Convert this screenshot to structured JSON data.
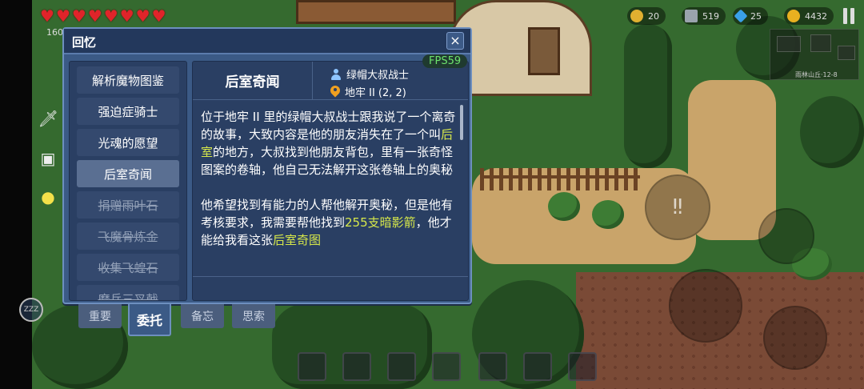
{
  "hud": {
    "hearts": 8,
    "hp_label": "160/",
    "resources": [
      {
        "icon": "star-badge-icon",
        "value": "20",
        "color": "#e0b030"
      },
      {
        "icon": "arrow-ammo-icon",
        "value": "519",
        "color": "#9aa3ad"
      },
      {
        "icon": "blue-gem-icon",
        "value": "25",
        "color": "#3aa0e8"
      },
      {
        "icon": "gold-coin-icon",
        "value": "4432",
        "color": "#e8b020"
      }
    ],
    "minimap_label": "雨林山丘·12-8",
    "sleep_label": "ZZZ"
  },
  "dialog": {
    "title": "回忆",
    "close_label": "×",
    "quest_list": [
      {
        "label": "解析魔物图鉴",
        "state": "normal"
      },
      {
        "label": "强迫症骑士",
        "state": "normal"
      },
      {
        "label": "光魂的愿望",
        "state": "normal"
      },
      {
        "label": "后室奇闻",
        "state": "selected"
      },
      {
        "label": "捐赠雨叶石",
        "state": "done"
      },
      {
        "label": "飞魔骨炼金",
        "state": "done"
      },
      {
        "label": "收集飞蝗石",
        "state": "done"
      },
      {
        "label": "磨兵三叉戟",
        "state": "done"
      }
    ],
    "quest": {
      "title": "后室奇闻",
      "giver": "绿帽大叔战士",
      "location": "地牢 II (2, 2)",
      "fps": "FPS59",
      "p1_a": "位于地牢 II 里的绿帽大叔战士跟我说了一个离奇的故事，大致内容是他的朋友消失在了一个叫",
      "p1_hl": "后室",
      "p1_b": "的地方，大叔找到他朋友背包，里有一张奇怪图案的卷轴，他自己无法解开这张卷轴上的奥秘",
      "p2_a": "他希望找到有能力的人帮他解开奥秘，但是他有考核要求，我需要帮他找到",
      "p2_hl1": "255支暗影箭",
      "p2_b": "，他才能给我看这张",
      "p2_hl2": "后室奇图"
    },
    "tabs": [
      {
        "label": "重要",
        "active": false
      },
      {
        "label": "委托",
        "active": true
      },
      {
        "label": "备忘",
        "active": false
      },
      {
        "label": "思索",
        "active": false
      }
    ]
  }
}
